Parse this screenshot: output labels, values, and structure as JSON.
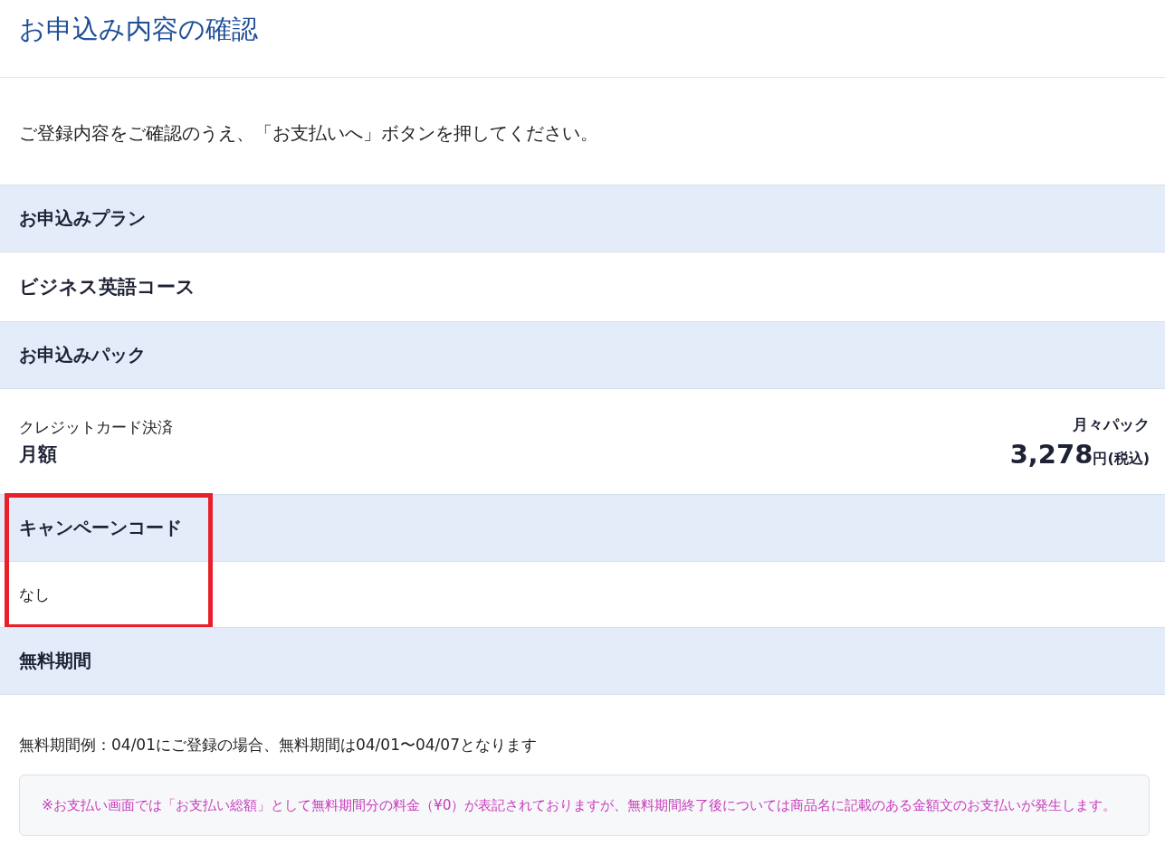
{
  "page_title": "お申込み内容の確認",
  "intro": "ご登録内容をご確認のうえ、「お支払いへ」ボタンを押してください。",
  "sections": [
    {
      "heading": "お申込みプラン",
      "highlighted": false,
      "kind": "value",
      "value": "ビジネス英語コース"
    },
    {
      "heading": "お申込みパック",
      "highlighted": false,
      "kind": "pack",
      "payment_method": "クレジットカード決済",
      "billing": "月額",
      "pack_name": "月々パック",
      "price": "3,278",
      "price_unit": "円(税込)"
    },
    {
      "heading": "キャンペーンコード",
      "highlighted": true,
      "kind": "plain",
      "value": "なし"
    },
    {
      "heading": "無料期間",
      "highlighted": false,
      "kind": "free",
      "example": "無料期間例：04/01にご登録の場合、無料期間は04/01〜04/07となります",
      "note": "※お支払い画面では「お支払い総額」として無料期間分の料金（¥0）が表記されておりますが、無料期間終了後については商品名に記載のある金額文のお支払いが発生します。"
    }
  ]
}
